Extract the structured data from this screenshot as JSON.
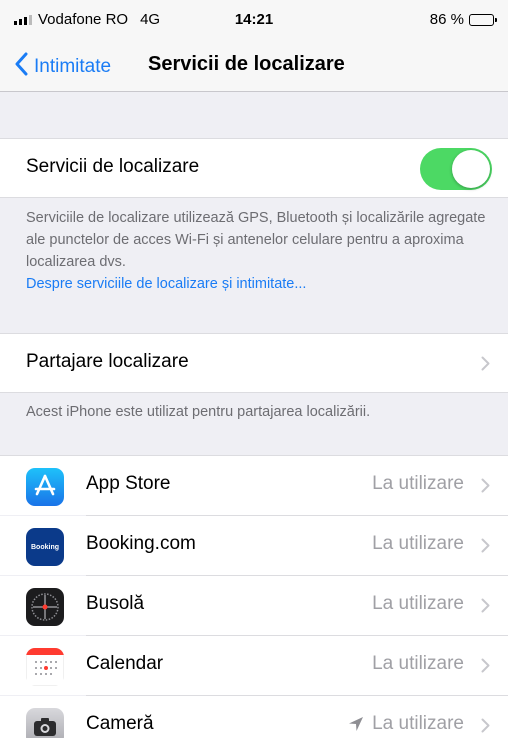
{
  "status_bar": {
    "carrier": "Vodafone RO",
    "network": "4G",
    "time": "14:21",
    "battery": "86 %",
    "battery_level": 0.86
  },
  "nav": {
    "back_label": "Intimitate",
    "title": "Servicii de localizare"
  },
  "location_services": {
    "label": "Servicii de localizare",
    "enabled": true,
    "footnote": "Serviciile de localizare utilizează GPS, Bluetooth și localizările agregate ale punctelor de acces Wi-Fi și antenelor celulare pentru a aproxima localizarea dvs.",
    "footnote_link": "Despre serviciile de localizare și intimitate..."
  },
  "share_location": {
    "label": "Partajare localizare",
    "footnote": "Acest iPhone este utilizat pentru partajarea localizării."
  },
  "apps": [
    {
      "name": "App Store",
      "value": "La utilizare",
      "icon": "app-store-icon",
      "location_arrow": false
    },
    {
      "name": "Booking.com",
      "value": "La utilizare",
      "icon": "booking-icon",
      "icon_text": "Booking",
      "location_arrow": false
    },
    {
      "name": "Busolă",
      "value": "La utilizare",
      "icon": "compass-icon",
      "location_arrow": false
    },
    {
      "name": "Calendar",
      "value": "La utilizare",
      "icon": "calendar-icon",
      "location_arrow": false
    },
    {
      "name": "Cameră",
      "value": "La utilizare",
      "icon": "camera-icon",
      "location_arrow": true
    }
  ],
  "colors": {
    "accent": "#1a7cf5",
    "toggle_on": "#4cd964",
    "background": "#efeff4",
    "secondary_text": "#a0a0a5"
  }
}
